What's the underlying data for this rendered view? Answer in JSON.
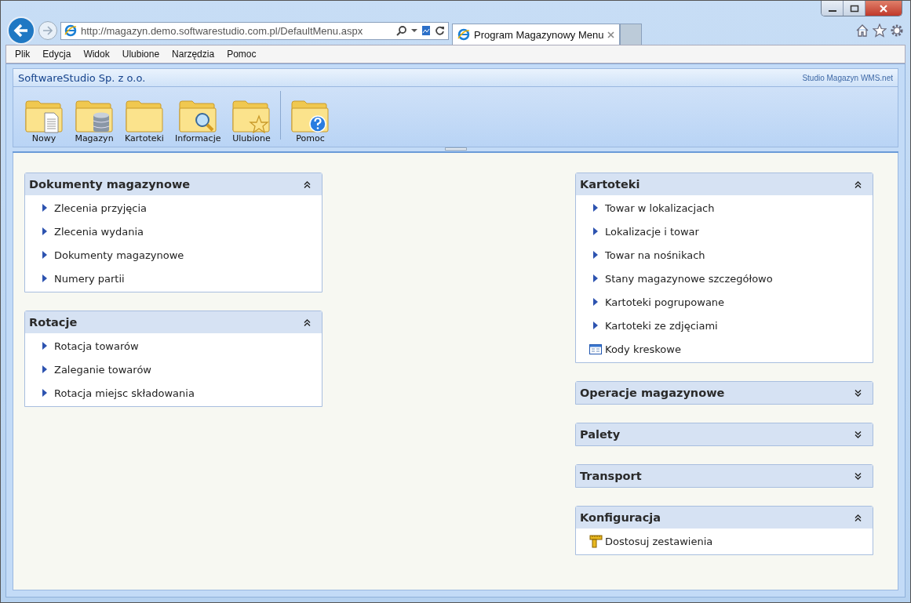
{
  "browser": {
    "address": "http://magazyn.demo.softwarestudio.com.pl/DefaultMenu.aspx",
    "tab": {
      "title": "Program Magazynowy Menu",
      "selected": true
    },
    "menu": [
      "Plik",
      "Edycja",
      "Widok",
      "Ulubione",
      "Narzędzia",
      "Pomoc"
    ]
  },
  "app": {
    "company": "SoftwareStudio Sp. z o.o.",
    "product": "Studio Magazyn WMS.net",
    "toolbar": [
      {
        "label": "Nowy",
        "kind": "document"
      },
      {
        "label": "Magazyn",
        "kind": "database"
      },
      {
        "label": "Kartoteki",
        "kind": "plain"
      },
      {
        "label": "Informacje",
        "kind": "magnifier"
      },
      {
        "label": "Ulubione",
        "kind": "star"
      },
      {
        "label": "Pomoc",
        "kind": "help"
      }
    ]
  },
  "columns": [
    [
      {
        "title": "Dokumenty magazynowe",
        "expanded": true,
        "items": [
          {
            "label": "Zlecenia przyjęcia",
            "kind": "arrow"
          },
          {
            "label": "Zlecenia wydania",
            "kind": "arrow"
          },
          {
            "label": "Dokumenty magazynowe",
            "kind": "arrow"
          },
          {
            "label": "Numery partii",
            "kind": "arrow"
          }
        ]
      },
      {
        "title": "Rotacje",
        "expanded": true,
        "items": [
          {
            "label": "Rotacja towarów",
            "kind": "arrow"
          },
          {
            "label": "Zaleganie towarów",
            "kind": "arrow"
          },
          {
            "label": "Rotacja miejsc składowania",
            "kind": "arrow"
          }
        ]
      }
    ],
    [
      {
        "title": "Kartoteki",
        "expanded": true,
        "items": [
          {
            "label": "Towar w lokalizacjach",
            "kind": "arrow"
          },
          {
            "label": "Lokalizacje i towar",
            "kind": "arrow"
          },
          {
            "label": "Towar na nośnikach",
            "kind": "arrow"
          },
          {
            "label": "Stany magazynowe szczegółowo",
            "kind": "arrow"
          },
          {
            "label": "Kartoteki pogrupowane",
            "kind": "arrow"
          },
          {
            "label": "Kartoteki ze zdjęciami",
            "kind": "arrow"
          },
          {
            "label": "Kody kreskowe",
            "kind": "barcode"
          }
        ]
      },
      {
        "title": "Operacje magazynowe",
        "expanded": false
      },
      {
        "title": "Palety",
        "expanded": false
      },
      {
        "title": "Transport",
        "expanded": false
      },
      {
        "title": "Konfiguracja",
        "expanded": true,
        "items": [
          {
            "label": "Dostosuj zestawienia",
            "kind": "ruler"
          }
        ]
      }
    ]
  ]
}
